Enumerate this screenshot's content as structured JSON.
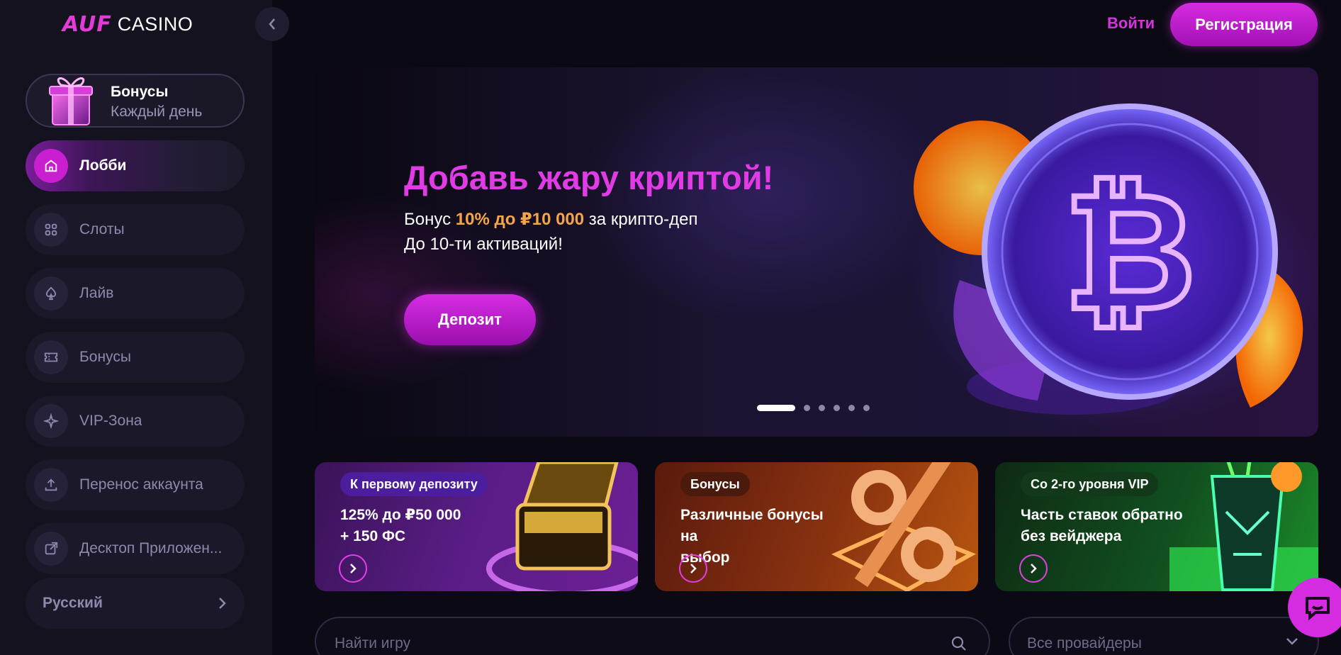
{
  "brand": {
    "logo_left": "AUF",
    "logo_right": "CASINO",
    "accent": "#d52ce1"
  },
  "sidebar": {
    "bonus_card": {
      "title": "Бонусы",
      "subtitle": "Каждый день",
      "icon": "gift-icon"
    },
    "items": [
      {
        "label": "Лобби",
        "icon": "home-icon",
        "active": true
      },
      {
        "label": "Слоты",
        "icon": "grid-icon",
        "active": false
      },
      {
        "label": "Лайв",
        "icon": "spade-icon",
        "active": false
      },
      {
        "label": "Бонусы",
        "icon": "ticket-icon",
        "active": false
      },
      {
        "label": "VIP-Зона",
        "icon": "sparkle-icon",
        "active": false
      },
      {
        "label": "Перенос аккаунта",
        "icon": "upload-icon",
        "active": false
      },
      {
        "label": "Десктоп Приложен...",
        "icon": "external-link-icon",
        "active": false
      }
    ],
    "language": {
      "label": "Русский",
      "icon": "chevron-right-icon"
    }
  },
  "header": {
    "login_label": "Войти",
    "register_label": "Регистрация"
  },
  "hero": {
    "title": "Добавь жару криптой!",
    "line1_prefix": "Бонус ",
    "line1_highlight": "10% до ₽10 000",
    "line1_suffix": " за крипто-деп",
    "line2": "До 10-ти активаций!",
    "button_label": "Депозит",
    "slide_count": 6,
    "active_slide": 1
  },
  "promos": [
    {
      "tag": "К первому депозиту",
      "text_line1": "125% до ₽50 000",
      "text_line2": "+ 150 ФС"
    },
    {
      "tag": "Бонусы",
      "text_line1": "Различные бонусы на",
      "text_line2": "выбор"
    },
    {
      "tag": "Со 2-го уровня VIP",
      "text_line1": "Часть ставок обратно",
      "text_line2": "без вейджера"
    }
  ],
  "search": {
    "placeholder": "Найти игру",
    "providers_label": "Все провайдеры"
  }
}
